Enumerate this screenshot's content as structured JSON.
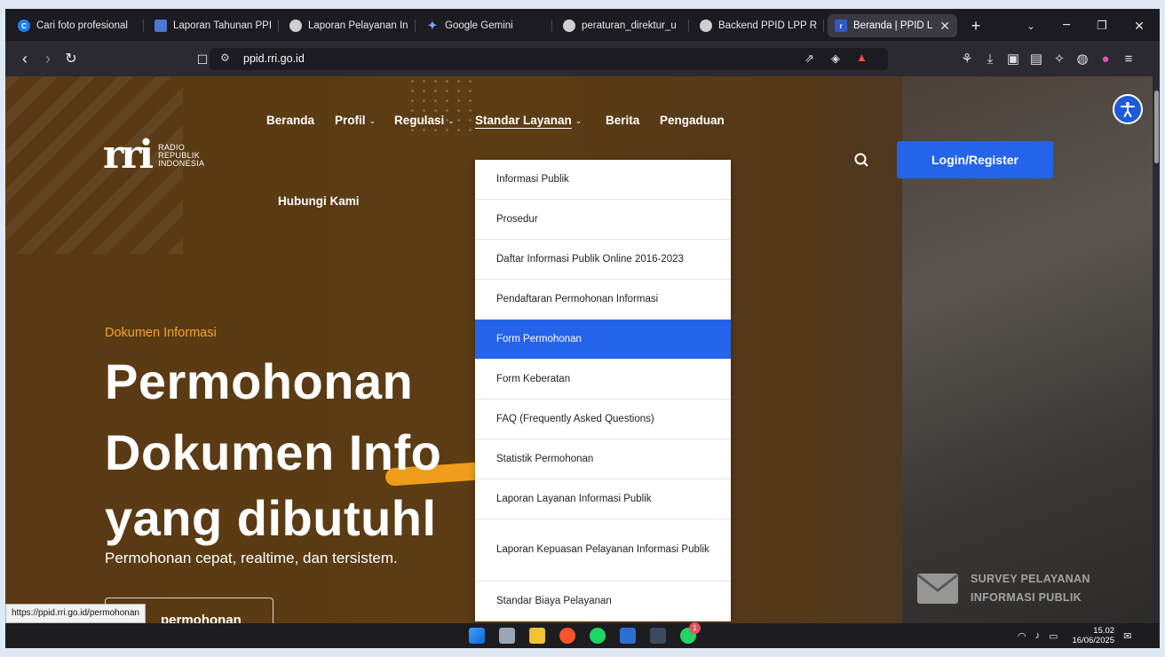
{
  "browser": {
    "tabs": [
      {
        "title": "Cari foto profesional",
        "icon": "canva-icon",
        "color": "#1b7ff0"
      },
      {
        "title": "Laporan Tahunan PPI",
        "icon": "document-icon",
        "color": "#4b77d1"
      },
      {
        "title": "Laporan Pelayanan In",
        "icon": "globe-icon",
        "color": "#cfcfcf"
      },
      {
        "title": "Google Gemini",
        "icon": "gemini-icon",
        "color": "#7aa2ff"
      },
      {
        "title": "peraturan_direktur_u",
        "icon": "globe-icon",
        "color": "#cfcfcf"
      },
      {
        "title": "Backend PPID LPP RR",
        "icon": "globe-icon",
        "color": "#cfcfcf"
      },
      {
        "title": "Beranda | PPID L",
        "icon": "rri-icon",
        "color": "#3058c8",
        "active": true
      }
    ],
    "new_tab": "+",
    "url": "ppid.rri.go.id",
    "status_url": "https://ppid.rri.go.id/permohonan"
  },
  "site": {
    "logo": {
      "mark": "rri",
      "line1": "RADIO",
      "line2": "REPUBLIK",
      "line3": "INDONESIA"
    },
    "nav": {
      "beranda": "Beranda",
      "profil": "Profil",
      "regulasi": "Regulasi",
      "standar": "Standar Layanan",
      "berita": "Berita",
      "pengaduan": "Pengaduan",
      "hubungi": "Hubungi Kami"
    },
    "login": "Login/Register",
    "dropdown": [
      "Informasi Publik",
      "Prosedur",
      "Daftar Informasi Publik Online 2016-2023",
      "Pendaftaran Permohonan Informasi",
      "Form Permohonan",
      "Form Keberatan",
      "FAQ (Frequently Asked Questions)",
      "Statistik Permohonan",
      "Laporan Layanan Informasi Publik",
      "Laporan Kepuasan Pelayanan Informasi Publik",
      "Standar Biaya Pelayanan"
    ],
    "dropdown_active": "Form Permohonan",
    "hero": {
      "eyebrow": "Dokumen Informasi",
      "line1": "Permohonan",
      "line2": "Dokumen Info",
      "line3": "yang dibutuhl",
      "tagline": "Permohonan cepat, realtime, dan tersistem.",
      "cta": "permohonan"
    },
    "survey": {
      "line1": "SURVEY PELAYANAN",
      "line2": "INFORMASI PUBLIK"
    }
  },
  "taskbar": {
    "clock_time": "15.02",
    "clock_date": "16/06/2025",
    "whatsapp_badge": "1"
  },
  "colors": {
    "accent": "#2563eb",
    "brand_orange": "#f5a623"
  }
}
